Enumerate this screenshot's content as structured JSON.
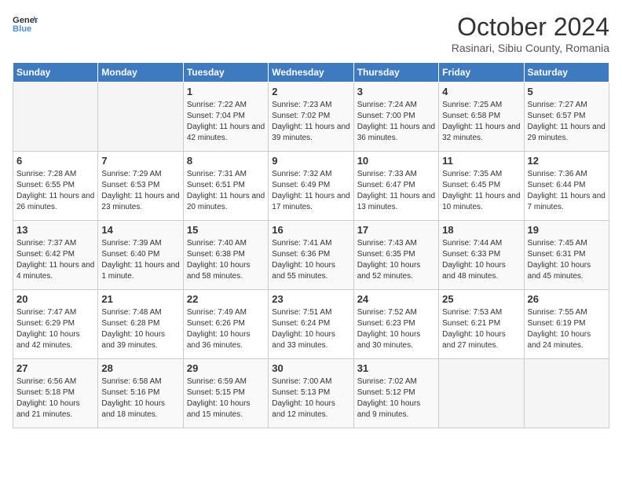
{
  "header": {
    "logo_line1": "General",
    "logo_line2": "Blue",
    "month": "October 2024",
    "location": "Rasinari, Sibiu County, Romania"
  },
  "weekdays": [
    "Sunday",
    "Monday",
    "Tuesday",
    "Wednesday",
    "Thursday",
    "Friday",
    "Saturday"
  ],
  "weeks": [
    [
      {
        "day": "",
        "empty": true
      },
      {
        "day": "",
        "empty": true
      },
      {
        "day": "1",
        "sunrise": "7:22 AM",
        "sunset": "7:04 PM",
        "daylight": "11 hours and 42 minutes."
      },
      {
        "day": "2",
        "sunrise": "7:23 AM",
        "sunset": "7:02 PM",
        "daylight": "11 hours and 39 minutes."
      },
      {
        "day": "3",
        "sunrise": "7:24 AM",
        "sunset": "7:00 PM",
        "daylight": "11 hours and 36 minutes."
      },
      {
        "day": "4",
        "sunrise": "7:25 AM",
        "sunset": "6:58 PM",
        "daylight": "11 hours and 32 minutes."
      },
      {
        "day": "5",
        "sunrise": "7:27 AM",
        "sunset": "6:57 PM",
        "daylight": "11 hours and 29 minutes."
      }
    ],
    [
      {
        "day": "6",
        "sunrise": "7:28 AM",
        "sunset": "6:55 PM",
        "daylight": "11 hours and 26 minutes."
      },
      {
        "day": "7",
        "sunrise": "7:29 AM",
        "sunset": "6:53 PM",
        "daylight": "11 hours and 23 minutes."
      },
      {
        "day": "8",
        "sunrise": "7:31 AM",
        "sunset": "6:51 PM",
        "daylight": "11 hours and 20 minutes."
      },
      {
        "day": "9",
        "sunrise": "7:32 AM",
        "sunset": "6:49 PM",
        "daylight": "11 hours and 17 minutes."
      },
      {
        "day": "10",
        "sunrise": "7:33 AM",
        "sunset": "6:47 PM",
        "daylight": "11 hours and 13 minutes."
      },
      {
        "day": "11",
        "sunrise": "7:35 AM",
        "sunset": "6:45 PM",
        "daylight": "11 hours and 10 minutes."
      },
      {
        "day": "12",
        "sunrise": "7:36 AM",
        "sunset": "6:44 PM",
        "daylight": "11 hours and 7 minutes."
      }
    ],
    [
      {
        "day": "13",
        "sunrise": "7:37 AM",
        "sunset": "6:42 PM",
        "daylight": "11 hours and 4 minutes."
      },
      {
        "day": "14",
        "sunrise": "7:39 AM",
        "sunset": "6:40 PM",
        "daylight": "11 hours and 1 minute."
      },
      {
        "day": "15",
        "sunrise": "7:40 AM",
        "sunset": "6:38 PM",
        "daylight": "10 hours and 58 minutes."
      },
      {
        "day": "16",
        "sunrise": "7:41 AM",
        "sunset": "6:36 PM",
        "daylight": "10 hours and 55 minutes."
      },
      {
        "day": "17",
        "sunrise": "7:43 AM",
        "sunset": "6:35 PM",
        "daylight": "10 hours and 52 minutes."
      },
      {
        "day": "18",
        "sunrise": "7:44 AM",
        "sunset": "6:33 PM",
        "daylight": "10 hours and 48 minutes."
      },
      {
        "day": "19",
        "sunrise": "7:45 AM",
        "sunset": "6:31 PM",
        "daylight": "10 hours and 45 minutes."
      }
    ],
    [
      {
        "day": "20",
        "sunrise": "7:47 AM",
        "sunset": "6:29 PM",
        "daylight": "10 hours and 42 minutes."
      },
      {
        "day": "21",
        "sunrise": "7:48 AM",
        "sunset": "6:28 PM",
        "daylight": "10 hours and 39 minutes."
      },
      {
        "day": "22",
        "sunrise": "7:49 AM",
        "sunset": "6:26 PM",
        "daylight": "10 hours and 36 minutes."
      },
      {
        "day": "23",
        "sunrise": "7:51 AM",
        "sunset": "6:24 PM",
        "daylight": "10 hours and 33 minutes."
      },
      {
        "day": "24",
        "sunrise": "7:52 AM",
        "sunset": "6:23 PM",
        "daylight": "10 hours and 30 minutes."
      },
      {
        "day": "25",
        "sunrise": "7:53 AM",
        "sunset": "6:21 PM",
        "daylight": "10 hours and 27 minutes."
      },
      {
        "day": "26",
        "sunrise": "7:55 AM",
        "sunset": "6:19 PM",
        "daylight": "10 hours and 24 minutes."
      }
    ],
    [
      {
        "day": "27",
        "sunrise": "6:56 AM",
        "sunset": "5:18 PM",
        "daylight": "10 hours and 21 minutes."
      },
      {
        "day": "28",
        "sunrise": "6:58 AM",
        "sunset": "5:16 PM",
        "daylight": "10 hours and 18 minutes."
      },
      {
        "day": "29",
        "sunrise": "6:59 AM",
        "sunset": "5:15 PM",
        "daylight": "10 hours and 15 minutes."
      },
      {
        "day": "30",
        "sunrise": "7:00 AM",
        "sunset": "5:13 PM",
        "daylight": "10 hours and 12 minutes."
      },
      {
        "day": "31",
        "sunrise": "7:02 AM",
        "sunset": "5:12 PM",
        "daylight": "10 hours and 9 minutes."
      },
      {
        "day": "",
        "empty": true
      },
      {
        "day": "",
        "empty": true
      }
    ]
  ]
}
